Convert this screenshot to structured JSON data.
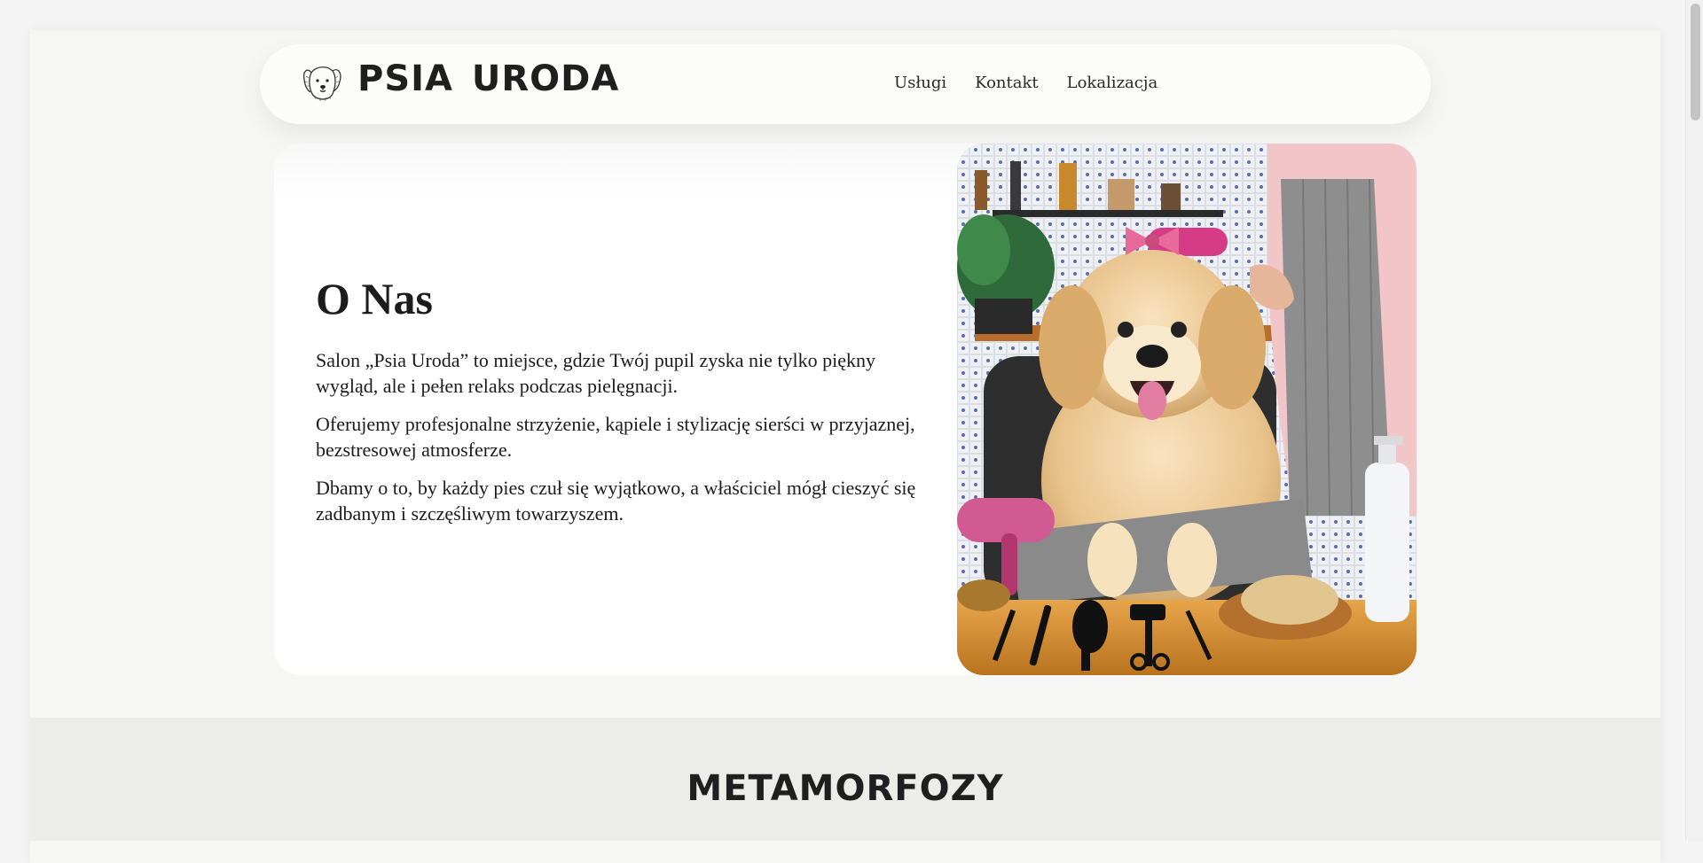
{
  "header": {
    "brand": "PSIA  URODA",
    "logo_icon": "dog-head-sketch-icon",
    "nav": [
      "Usługi",
      "Kontakt",
      "Lokalizacja"
    ]
  },
  "about": {
    "title": "O Nas",
    "paragraphs": [
      "Salon „Psia Uroda” to miejsce, gdzie Twój pupil zyska nie tylko piękny wygląd, ale i pełen relaks podczas pielęgnacji.",
      "Oferujemy profesjonalne strzyżenie, kąpiele i stylizację sierści w przyjaznej, bezstresowej atmosferze.",
      "Dbamy o to, by każdy pies czuł się wyjątkowo, a właściciel mógł cieszyć się zadbanym i szczęśliwym towarzyszem."
    ],
    "image_subject": "golden-retriever-grooming-photo"
  },
  "metamorfozy": {
    "title": "METAMORFOZY"
  },
  "colors": {
    "page_bg": "#f6f6f5",
    "header_bg": "#fcfcfb",
    "section_bg": "#ecede9",
    "text": "#1f1f1f",
    "accent_pink": "#d63b85"
  }
}
